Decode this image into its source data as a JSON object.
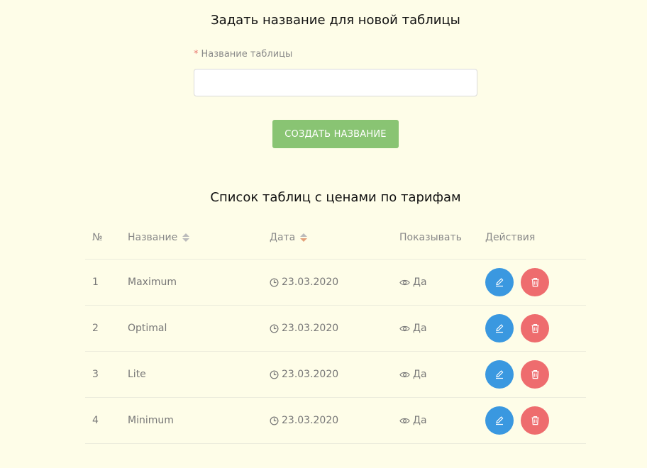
{
  "form": {
    "title": "Задать название для новой таблицы",
    "required_mark": "*",
    "field_label": "Название таблицы",
    "field_value": "",
    "field_placeholder": "",
    "submit_label": "СОЗДАТЬ НАЗВАНИЕ"
  },
  "list": {
    "title": "Список таблиц с ценами по тарифам",
    "columns": {
      "num": "№",
      "name": "Название",
      "date": "Дата",
      "show": "Показывать",
      "actions": "Действия"
    },
    "rows": [
      {
        "num": "1",
        "name": "Maximum",
        "date": "23.03.2020",
        "show": "Да"
      },
      {
        "num": "2",
        "name": "Optimal",
        "date": "23.03.2020",
        "show": "Да"
      },
      {
        "num": "3",
        "name": "Lite",
        "date": "23.03.2020",
        "show": "Да"
      },
      {
        "num": "4",
        "name": "Minimum",
        "date": "23.03.2020",
        "show": "Да"
      }
    ]
  },
  "icons": {
    "date": "clock-icon",
    "show": "eye-icon",
    "edit": "pencil-icon",
    "delete": "trash-icon",
    "sort": "sort-icon"
  },
  "colors": {
    "background": "#fefde8",
    "submit_button": "#89c473",
    "edit_button": "#3a98e0",
    "delete_button": "#ee6c6e",
    "required_mark": "#e8776f"
  }
}
